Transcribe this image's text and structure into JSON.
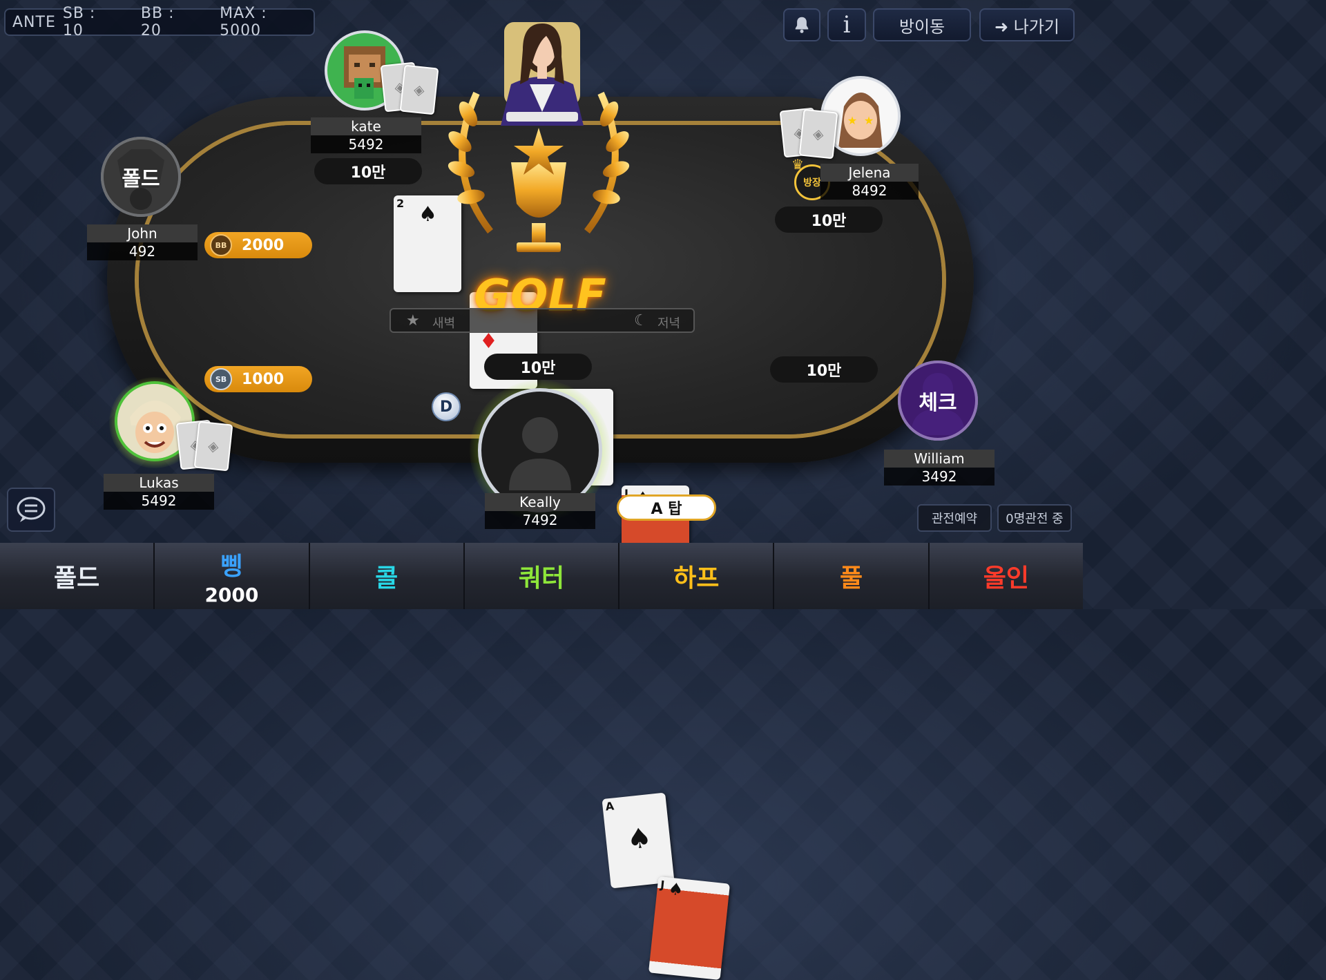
{
  "blinds": {
    "ante": "ANTE",
    "sb": "SB :  10",
    "bb": "BB : 20",
    "max": "MAX : 5000"
  },
  "top_buttons": {
    "notice_icon": "bell-icon",
    "info": "i",
    "move_room": "방이동",
    "exit": "➜ 나가기"
  },
  "players": [
    {
      "seat": "kate",
      "name": "kate",
      "chips": "5492",
      "bet": "10만"
    },
    {
      "seat": "john",
      "name": "John",
      "chips": "492",
      "status": "폴드"
    },
    {
      "seat": "jelena",
      "name": "Jelena",
      "chips": "8492",
      "bet": "10만",
      "host_badge": "방장"
    },
    {
      "seat": "lukas",
      "name": "Lukas",
      "chips": "5492"
    },
    {
      "seat": "keally",
      "name": "Keally",
      "chips": "7492",
      "bet": "10만"
    },
    {
      "seat": "william",
      "name": "William",
      "chips": "3492",
      "bet": "10만",
      "status": "체크"
    }
  ],
  "blind_chips": {
    "bb_label": "BB",
    "bb_amount": "2000",
    "sb_label": "SB",
    "sb_amount": "1000"
  },
  "dealer_button": "D",
  "hand_result": "GOLF",
  "hand_rank": "A 탑",
  "pot_bar": {
    "left": "새벽",
    "right": "저녁"
  },
  "community_cards": [
    {
      "rank": "2",
      "suit": "♠",
      "color": "#111"
    },
    {
      "rank": "",
      "suit": "♦",
      "color": "#e02020"
    },
    {
      "rank": "J",
      "suit": "♠",
      "color": "#111"
    }
  ],
  "my_cards": [
    {
      "rank": "A",
      "suit": "♠"
    },
    {
      "rank": "J",
      "suit": "♠"
    }
  ],
  "spectate": {
    "reserve": "관전예약",
    "watching": "0명관전 중"
  },
  "actions": [
    {
      "label": "폴드",
      "color": "#e9eef5"
    },
    {
      "label": "삥",
      "amount": "2000",
      "color": "#3aa2ff"
    },
    {
      "label": "콜",
      "color": "#28d7e6"
    },
    {
      "label": "쿼터",
      "color": "#8ee63a"
    },
    {
      "label": "하프",
      "color": "#ffbf1a"
    },
    {
      "label": "풀",
      "color": "#ff8a1a"
    },
    {
      "label": "올인",
      "color": "#ff3b2a"
    }
  ]
}
